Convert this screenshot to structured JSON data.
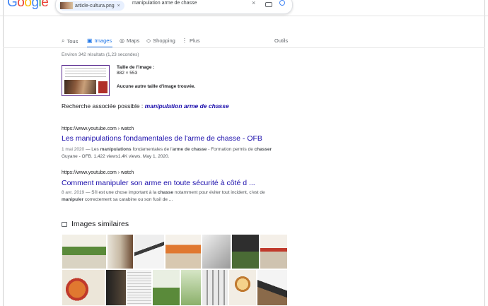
{
  "search": {
    "logo": "Google",
    "chip_label": "article-cultura.png",
    "chip_close": "×",
    "query": "manipulation arme de chasse",
    "clear": "×"
  },
  "tabs": [
    {
      "label": "Tous",
      "icon": "search-icon"
    },
    {
      "label": "Images",
      "icon": "image-icon",
      "active": true
    },
    {
      "label": "Maps",
      "icon": "map-pin-icon"
    },
    {
      "label": "Shopping",
      "icon": "tag-icon"
    },
    {
      "label": "Plus",
      "icon": "more-vert-icon"
    }
  ],
  "tools": "Outils",
  "stats": "Environ 342 résultats (1,23 secondes)",
  "image_info": {
    "size_label": "Taille de l'image :",
    "size_value": "882 × 553",
    "no_other": "Aucune autre taille d'image trouvée."
  },
  "related": {
    "prefix": "Recherche associée possible : ",
    "link": "manipulation arme de chasse"
  },
  "results": [
    {
      "url": "https://www.youtube.com › watch",
      "title": "Les manipulations fondamentales de l'arme de chasse - OFB",
      "date": "1 mai 2020",
      "snippet": "1 mai 2020 — Les manipulations fondamentales de l'arme de chasse - Formation permis de chasser Guyane - OFB. 1,422 views1.4K views. May 1, 2020."
    },
    {
      "url": "https://www.youtube.com › watch",
      "title": "Comment manipuler son arme en toute sécurité à côté d ...",
      "date": "8 avr. 2019",
      "snippet": "8 avr. 2019 — S'il est une chose important à la chasse notamment pour éviter tout incident, c'est de manipuler correctement sa carabine ou son fusil de ..."
    }
  ],
  "similar": {
    "heading": "Images similaires",
    "colors": {
      "green": "#5a8a3a",
      "orange": "#e07830",
      "red": "#c0392b",
      "brown": "#6b4a32",
      "gray": "#9a9a9a",
      "dark": "#2e2e2e"
    }
  }
}
